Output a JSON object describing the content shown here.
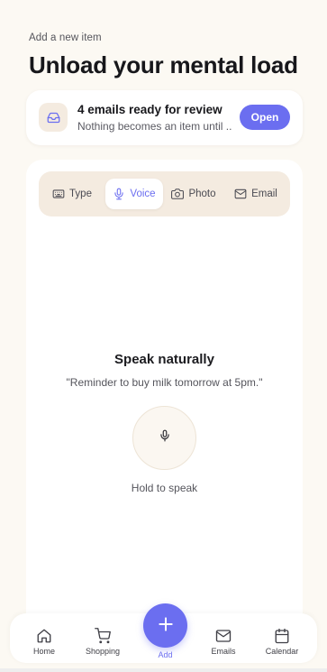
{
  "header": {
    "eyebrow": "Add a new item",
    "title": "Unload your mental load"
  },
  "review_card": {
    "icon": "inbox-icon",
    "title": "4 emails ready for review",
    "subtitle": "Nothing becomes an item until ...",
    "button_label": "Open"
  },
  "mode_tabs": {
    "active": "Voice",
    "items": [
      {
        "label": "Type",
        "icon": "keyboard-icon"
      },
      {
        "label": "Voice",
        "icon": "microphone-icon"
      },
      {
        "label": "Photo",
        "icon": "camera-icon"
      },
      {
        "label": "Email",
        "icon": "mail-icon"
      }
    ]
  },
  "voice_panel": {
    "title": "Speak naturally",
    "example": "\"Reminder to buy milk tomorrow at 5pm.\"",
    "mic_icon": "microphone-icon",
    "hold_label": "Hold to speak"
  },
  "bottom_nav": {
    "items": [
      {
        "label": "Home",
        "icon": "home-icon"
      },
      {
        "label": "Shopping",
        "icon": "shopping-cart-icon"
      },
      {
        "label": "Add",
        "icon": "plus-icon"
      },
      {
        "label": "Emails",
        "icon": "mail-icon"
      },
      {
        "label": "Calendar",
        "icon": "calendar-icon"
      }
    ]
  },
  "colors": {
    "accent": "#6b6ef0",
    "background": "#fcf9f3",
    "tab_track": "#f4ebe0"
  }
}
